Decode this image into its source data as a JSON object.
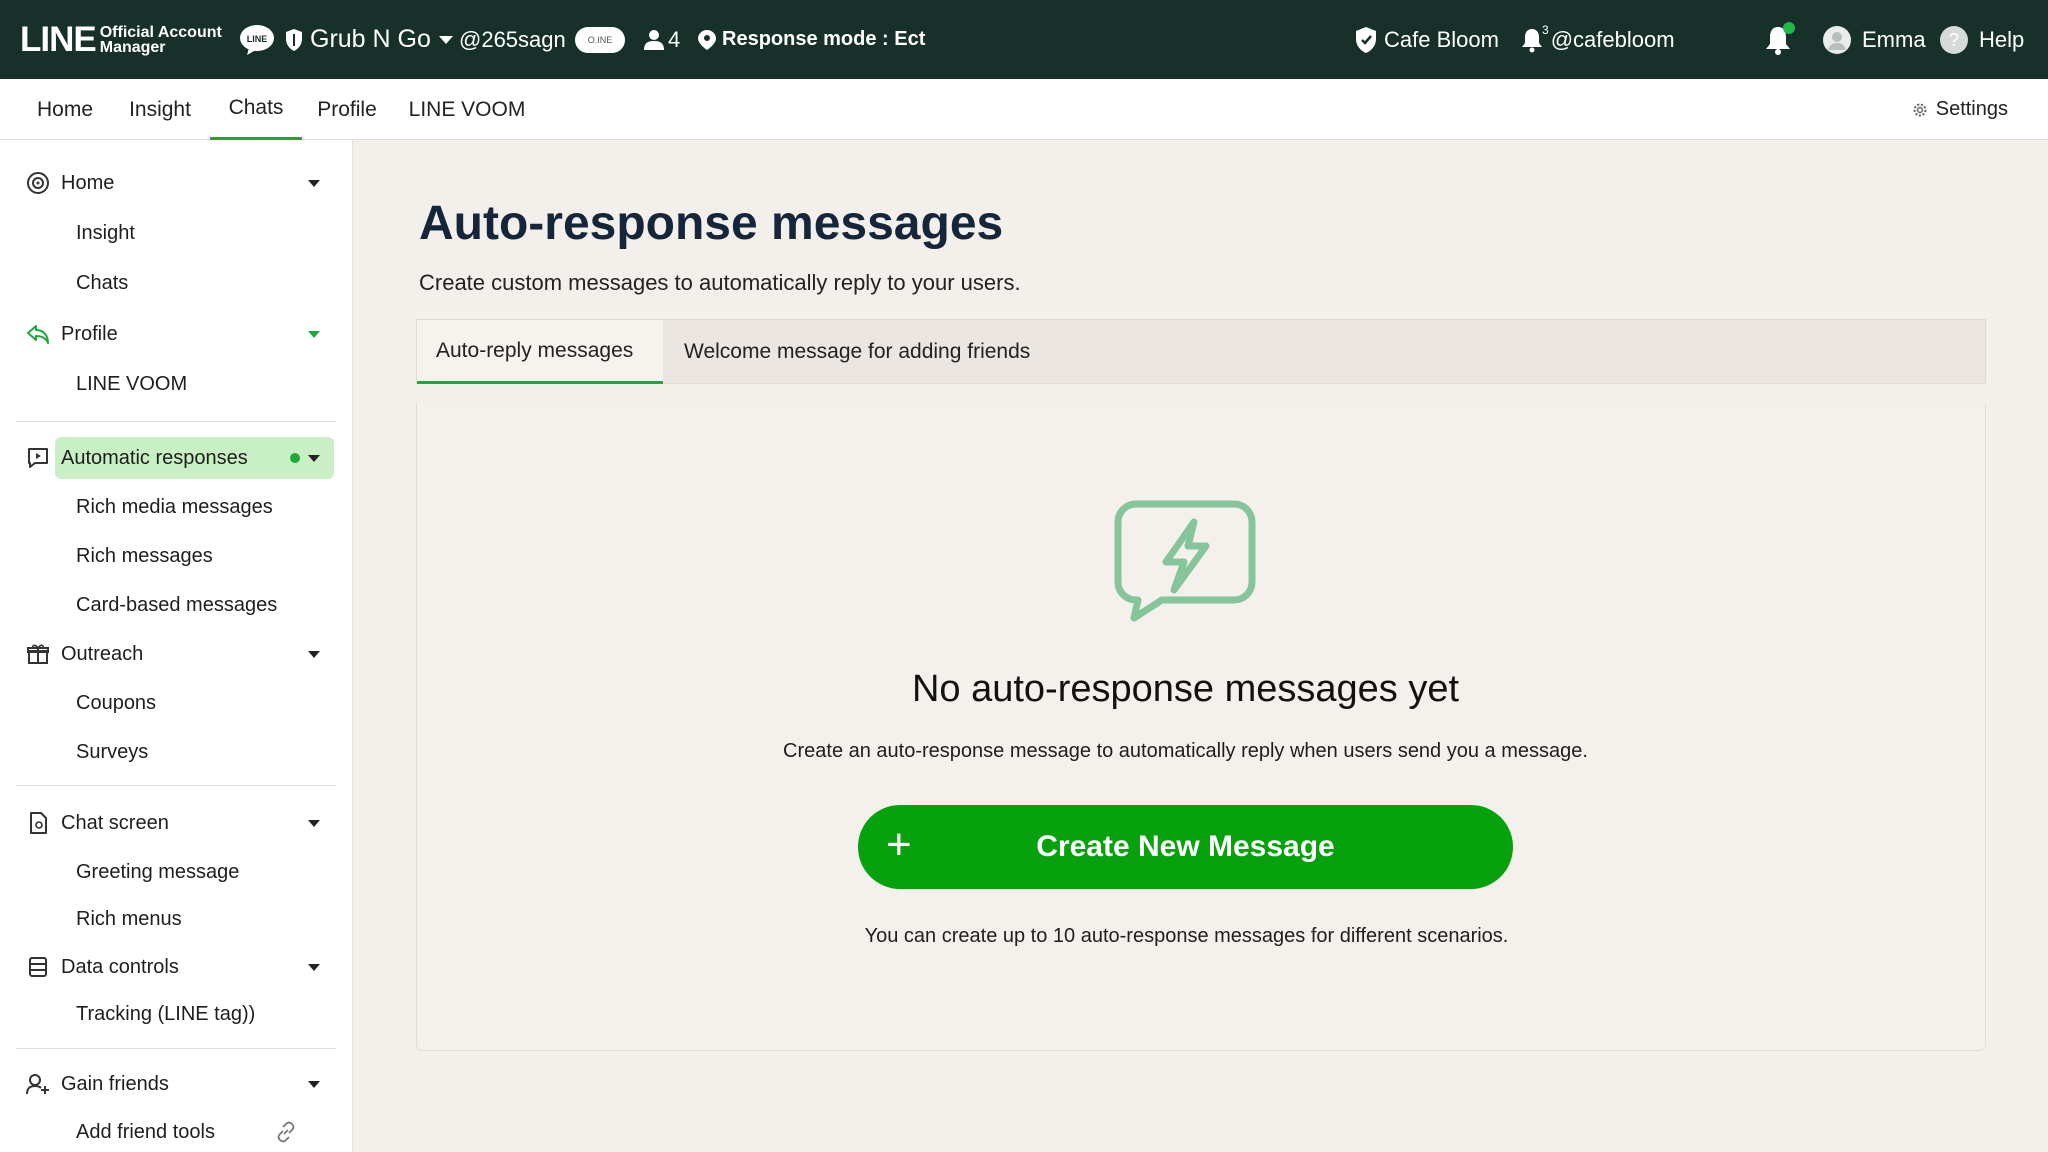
{
  "header": {
    "brand_line": "LINE",
    "brand_sub_1": "Official Account",
    "brand_sub_2": "Manager",
    "account_name": "Grub N Go",
    "account_id": "@265sagn",
    "line_toggle": "O.INE",
    "friend_count": "4",
    "response_mode": "Response mode : Ect",
    "shop_name": "Cafe Bloom",
    "shop_notif_count": "3",
    "shop_handle": "@cafebloom",
    "user_name": "Emma",
    "help_label": "Help"
  },
  "nav": {
    "tabs": [
      {
        "label": "Home"
      },
      {
        "label": "Insight"
      },
      {
        "label": "Chats"
      },
      {
        "label": "Profile"
      },
      {
        "label": "LINE VOOM"
      }
    ],
    "active_tab": "Chats",
    "settings_label": "Settings"
  },
  "sidebar": {
    "home": {
      "label": "Home",
      "children": [
        "Insight",
        "Chats"
      ]
    },
    "profile": {
      "label": "Profile",
      "children": [
        "LINE VOOM"
      ]
    },
    "automatic": {
      "label": "Automatic responses",
      "children": [
        "Rich media messages",
        "Rich messages",
        "Card-based messages"
      ]
    },
    "outreach": {
      "label": "Outreach",
      "children": [
        "Coupons",
        "Surveys"
      ]
    },
    "chat_screen": {
      "label": "Chat screen",
      "children": [
        "Greeting message",
        "Rich menus"
      ]
    },
    "data_controls": {
      "label": "Data controls",
      "children": [
        "Tracking (LINE tag))"
      ]
    },
    "gain_friends": {
      "label": "Gain friends",
      "children": [
        "Add friend tools"
      ]
    }
  },
  "main": {
    "title": "Auto-response messages",
    "subtitle": "Create custom messages to automatically reply to your users.",
    "tabs": [
      {
        "label": "Auto-reply messages"
      },
      {
        "label": "Welcome message for adding friends"
      }
    ],
    "empty_state": {
      "icon": "lightning-chat-icon",
      "title": "No auto-response messages yet",
      "description": "Create an auto-response message to automatically reply when users send you a message.",
      "button_icon": "+",
      "button_label": "Create New Message",
      "note": "You can create up to 10 auto-response messages for different scenarios."
    }
  },
  "colors": {
    "header_bg": "#17302a",
    "accent_green": "#06a10c",
    "active_sidebar_bg": "#c9f0c4",
    "icon_green": "#7fc38f"
  }
}
